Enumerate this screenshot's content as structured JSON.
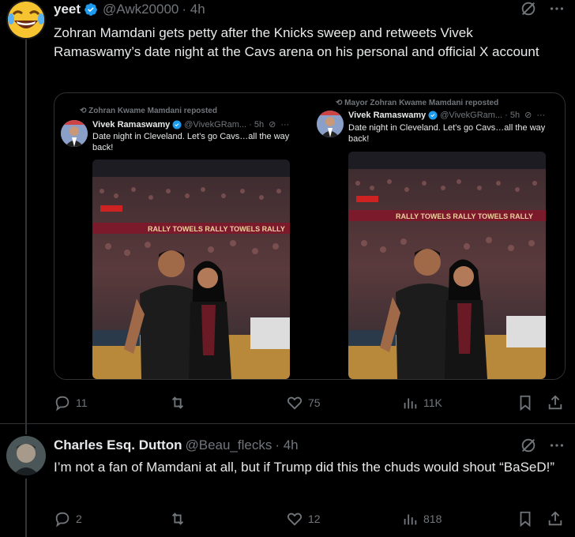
{
  "post1": {
    "name": "yeet",
    "handle": "@Awk20000",
    "time": "· 4h",
    "text": "Zohran Mamdani gets petty after the Knicks sweep and retweets Vivek Ramaswamy’s date night at the Cavs arena on his personal and official X account",
    "stats": {
      "replies": "11",
      "reposts": "",
      "likes": "75",
      "views": "11K"
    },
    "quotes": [
      {
        "repost_line": "Zohran Kwame Mamdani reposted",
        "name": "Vivek Ramaswamy",
        "handle_time": "@VivekGRam... · 5h",
        "text": "Date night in Cleveland. Let’s go Cavs…all the way back!",
        "banner": "RALLY TOWELS RALLY TOWELS RALLY"
      },
      {
        "repost_line": "Mayor Zohran Kwame Mamdani reposted",
        "name": "Vivek Ramaswamy",
        "handle_time": "@VivekGRam... · 5h",
        "text": "Date night in Cleveland. Let’s go Cavs…all the way back!",
        "banner": "RALLY TOWELS RALLY TOWELS RALLY"
      }
    ]
  },
  "post2": {
    "name": "Charles Esq. Dutton",
    "handle": "@Beau_flecks",
    "time": "· 4h",
    "text": "I’m not a fan of Mamdani at all, but if Trump did this the chuds would shout “BaSeD!”",
    "stats": {
      "replies": "2",
      "reposts": "",
      "likes": "12",
      "views": "818"
    }
  },
  "colors": {
    "bg": "#000000",
    "text": "#e7e9ea",
    "muted": "#71767b",
    "verified": "#1d9bf0",
    "border": "#2f3336"
  }
}
